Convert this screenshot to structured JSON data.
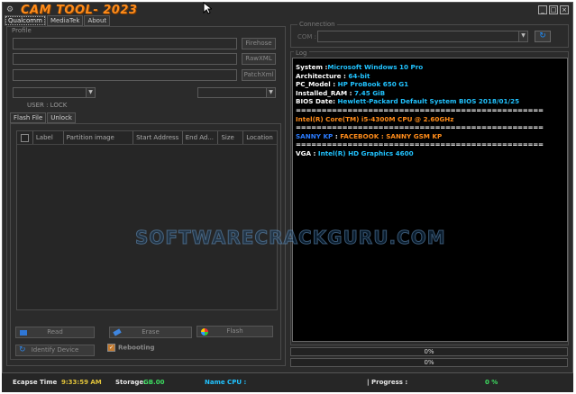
{
  "app": {
    "title": "CAM TOOL- 2023",
    "window_buttons": [
      "minimize-icon",
      "maximize-icon",
      "close-icon"
    ]
  },
  "tabs": [
    {
      "label": "Qualcomm",
      "active": true
    },
    {
      "label": "MediaTek",
      "active": false
    },
    {
      "label": "About",
      "active": false
    }
  ],
  "profile": {
    "label": "Profile",
    "firehose_btn": "Firehose",
    "rawxml_btn": "RawXML",
    "patchxml_btn": "PatchXml",
    "user_status": "USER : LOCK"
  },
  "subtabs": [
    {
      "label": "Flash File",
      "active": true
    },
    {
      "label": "Unlock",
      "active": false
    }
  ],
  "grid": {
    "columns": [
      "Label",
      "Partition image",
      "Start Address",
      "End Ad...",
      "Size",
      "Location"
    ]
  },
  "actions": {
    "read": "Read",
    "erase": "Erase",
    "flash": "Flash",
    "identify": "Identify Device",
    "rebooting": "Rebooting",
    "rebooting_checked": true
  },
  "connection": {
    "label": "Connection",
    "com_label": "COM :",
    "com_value": ""
  },
  "log": {
    "label": "Log",
    "lines": [
      {
        "key": "System :",
        "value": "Microsoft Windows 10 Pro",
        "style": "kv"
      },
      {
        "key": "Architecture : ",
        "value": "64-bit",
        "style": "kv"
      },
      {
        "key": "PC_Model : ",
        "value": "HP ProBook 650 G1",
        "style": "kv"
      },
      {
        "key": "Installed_RAM : ",
        "value": "7.45 GiB",
        "style": "kv"
      },
      {
        "key": "BIOS Date: ",
        "value": "Hewlett-Packard Default System BIOS 2018/01/25",
        "style": "kv"
      },
      {
        "text": "================================================",
        "style": "sep"
      },
      {
        "text": "Intel(R) Core(TM) i5-4300M CPU @ 2.60GHz",
        "style": "orange"
      },
      {
        "text": "================================================",
        "style": "sep"
      },
      {
        "text": "SANNY KP : FACEBOOK : SANNY GSM KP",
        "style": "mixed"
      },
      {
        "text": "================================================",
        "style": "sep"
      },
      {
        "key": "VGA : ",
        "value": "Intel(R) HD Graphics 4600",
        "style": "kv"
      }
    ]
  },
  "progress": [
    {
      "value": 0,
      "label": "0%"
    },
    {
      "value": 0,
      "label": "0%"
    }
  ],
  "watermark": "SOFTWARECRACKGURU.COM",
  "statusbar": {
    "elapse_label": "Ecapse Time",
    "elapse_value": "9:33:59 AM",
    "storage_label": "Storage:",
    "storage_value": "GB.00",
    "cpu_label": "Name CPU :",
    "cpu_value": "",
    "progress_label": "| Progress :",
    "progress_value": "0 %"
  },
  "colors": {
    "accent": "#ff8c1a",
    "value": "#21c3ff",
    "link": "#2a7bff",
    "background": "#2b2b2b"
  }
}
